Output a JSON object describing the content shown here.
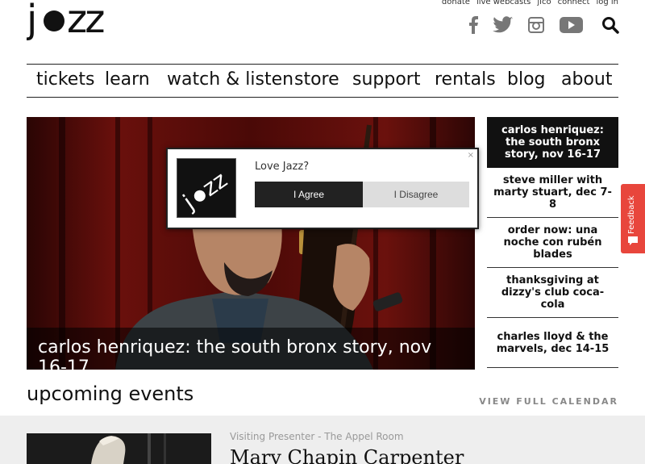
{
  "logo": {
    "text": "jazz"
  },
  "top_links": [
    "donate",
    "live webcasts",
    "jlco",
    "connect",
    "log in"
  ],
  "social_icons": [
    "facebook-icon",
    "twitter-icon",
    "instagram-icon",
    "youtube-icon",
    "search-icon"
  ],
  "nav": [
    "tickets",
    "learn",
    "watch & listen",
    "store",
    "support",
    "rentals",
    "blog",
    "about"
  ],
  "hero": {
    "caption": "carlos henriquez: the south bronx story, nov 16-17"
  },
  "side_list": [
    "carlos henriquez: the south bronx story, nov 16-17",
    "steve miller with marty stuart, dec 7-8",
    "order now: una noche con rubén blades",
    "thanksgiving at dizzy's club coca-cola",
    "charles lloyd & the marvels, dec 14-15"
  ],
  "feedback": {
    "label": "Feedback"
  },
  "popup": {
    "logo_text": "jazz",
    "question": "Love Jazz?",
    "agree": "I Agree",
    "disagree": "I Disagree",
    "close": "×"
  },
  "upcoming": {
    "heading": "upcoming events",
    "view_calendar": "VIEW FULL CALENDAR",
    "event_venue": "Visiting Presenter - The Appel Room",
    "event_title": "Mary Chapin Carpenter"
  },
  "colors": {
    "accent": "#e8463c",
    "dark": "#111111",
    "band": "#eeeeee"
  }
}
